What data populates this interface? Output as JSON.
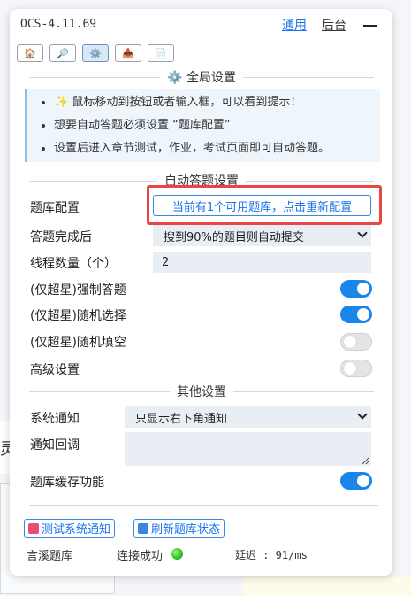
{
  "app": {
    "title": "OCS-4.11.69"
  },
  "header": {
    "nav_general": "通用",
    "nav_backend": "后台"
  },
  "toolbar": {
    "icons": [
      "home-icon",
      "search-icon",
      "gear-icon",
      "download-icon",
      "document-icon"
    ],
    "active_index": 2,
    "glyphs": [
      "🏠",
      "🔎",
      "⚙️",
      "📥",
      "📄"
    ]
  },
  "global_settings": {
    "title": "全局设置",
    "title_icon": "⚙️",
    "notices": [
      "✨ 鼠标移动到按钮或者输入框，可以看到提示！",
      "想要自动答题必须设置 “题库配置”",
      "设置后进入章节测试，作业，考试页面即可自动答题。"
    ]
  },
  "auto_answer": {
    "title": "自动答题设置",
    "question_bank_label": "题库配置",
    "question_bank_button": "当前有1个可用题库，点击重新配置",
    "completion_label": "答题完成后",
    "completion_value": "搜到90%的题目则自动提交",
    "threads_label": "线程数量（个）",
    "threads_value": "2",
    "force_answer_label": "(仅超星)强制答题",
    "force_answer_on": true,
    "random_select_label": "(仅超星)随机选择",
    "random_select_on": true,
    "random_fill_label": "(仅超星)随机填空",
    "random_fill_on": false,
    "advanced_label": "高级设置",
    "advanced_on": false
  },
  "other_settings": {
    "title": "其他设置",
    "notify_label": "系统通知",
    "notify_value": "只显示右下角通知",
    "callback_label": "通知回调",
    "callback_value": "",
    "cache_label": "题库缓存功能",
    "cache_on": true
  },
  "actions": {
    "test_notify": "测试系统通知",
    "refresh_bank": "刷新题库状态"
  },
  "footer": {
    "bank_name": "言溪题库",
    "connection": "连接成功",
    "latency": "延迟 : 91/ms"
  },
  "background": {
    "partial_char": "灵"
  },
  "colors": {
    "accent": "#1a86ec",
    "highlight": "#e84545",
    "status_ok": "#2cbf25"
  }
}
